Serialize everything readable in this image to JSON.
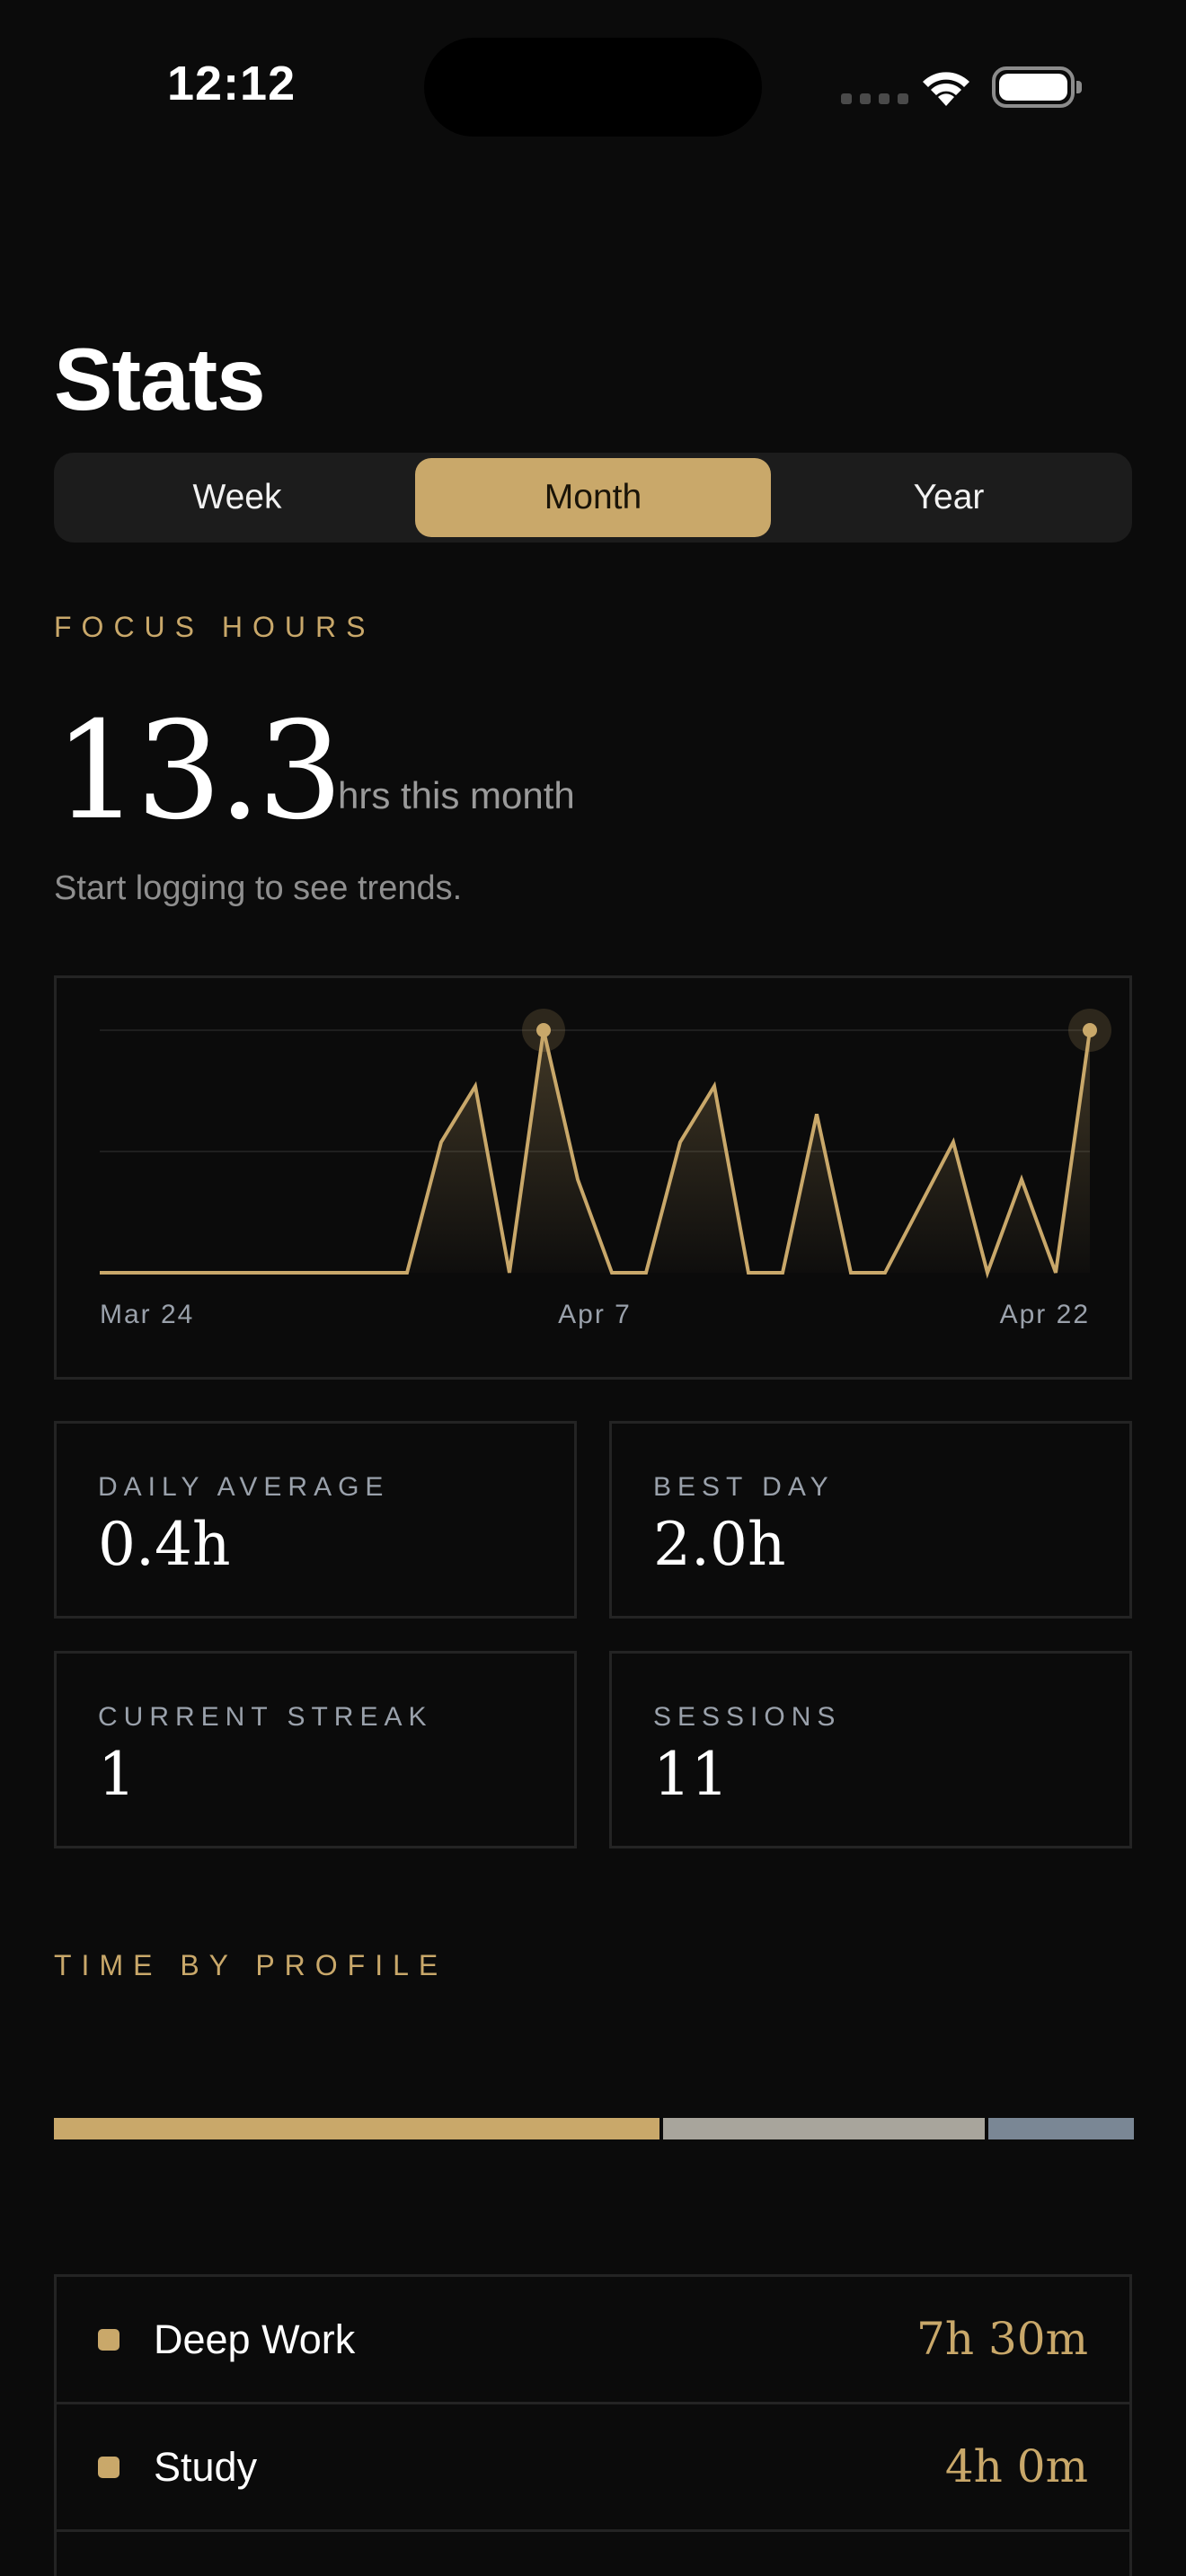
{
  "status_bar": {
    "time": "12:12"
  },
  "page": {
    "title": "Stats"
  },
  "period_tabs": [
    {
      "label": "Week",
      "selected": false
    },
    {
      "label": "Month",
      "selected": true
    },
    {
      "label": "Year",
      "selected": false
    }
  ],
  "focus": {
    "section_label": "FOCUS HOURS",
    "total": "13.3",
    "unit": "hrs this month",
    "trend_note": "Start logging to see trends."
  },
  "chart_data": {
    "type": "area",
    "x_tick_labels": [
      "Mar 24",
      "Apr 7",
      "Apr 22"
    ],
    "values": [
      0,
      0,
      0,
      0,
      0,
      0,
      0,
      0,
      0,
      0,
      1.4,
      2.0,
      0,
      2.6,
      1.0,
      0,
      0,
      1.4,
      2.0,
      0,
      0,
      1.7,
      0,
      0,
      0.7,
      1.4,
      0,
      1.0,
      0,
      2.6
    ],
    "highlight_points": [
      13,
      29
    ],
    "grid": true,
    "ylim": [
      0,
      2.6
    ],
    "color": "#c9a86a"
  },
  "stats": [
    {
      "label": "DAILY AVERAGE",
      "value": "0.4h"
    },
    {
      "label": "BEST DAY",
      "value": "2.0h"
    },
    {
      "label": "CURRENT STREAK",
      "value": "1"
    },
    {
      "label": "SESSIONS",
      "value": "11"
    }
  ],
  "profiles_section": {
    "label": "TIME BY PROFILE",
    "segments": [
      {
        "name": "Deep Work",
        "share": 0.5625,
        "color": "#c9a86a"
      },
      {
        "name": "Study",
        "share": 0.3,
        "color": "#a8a59c"
      },
      {
        "name": "Other",
        "share": 0.1375,
        "color": "#7a8795"
      }
    ],
    "rows": [
      {
        "name": "Deep Work",
        "time": "7h 30m",
        "color": "#c9a86a"
      },
      {
        "name": "Study",
        "time": "4h 0m",
        "color": "#c9a86a"
      }
    ]
  },
  "icons": {
    "wifi": "wifi-icon",
    "battery": "battery-icon",
    "signal": "cellular-signal-icon"
  }
}
